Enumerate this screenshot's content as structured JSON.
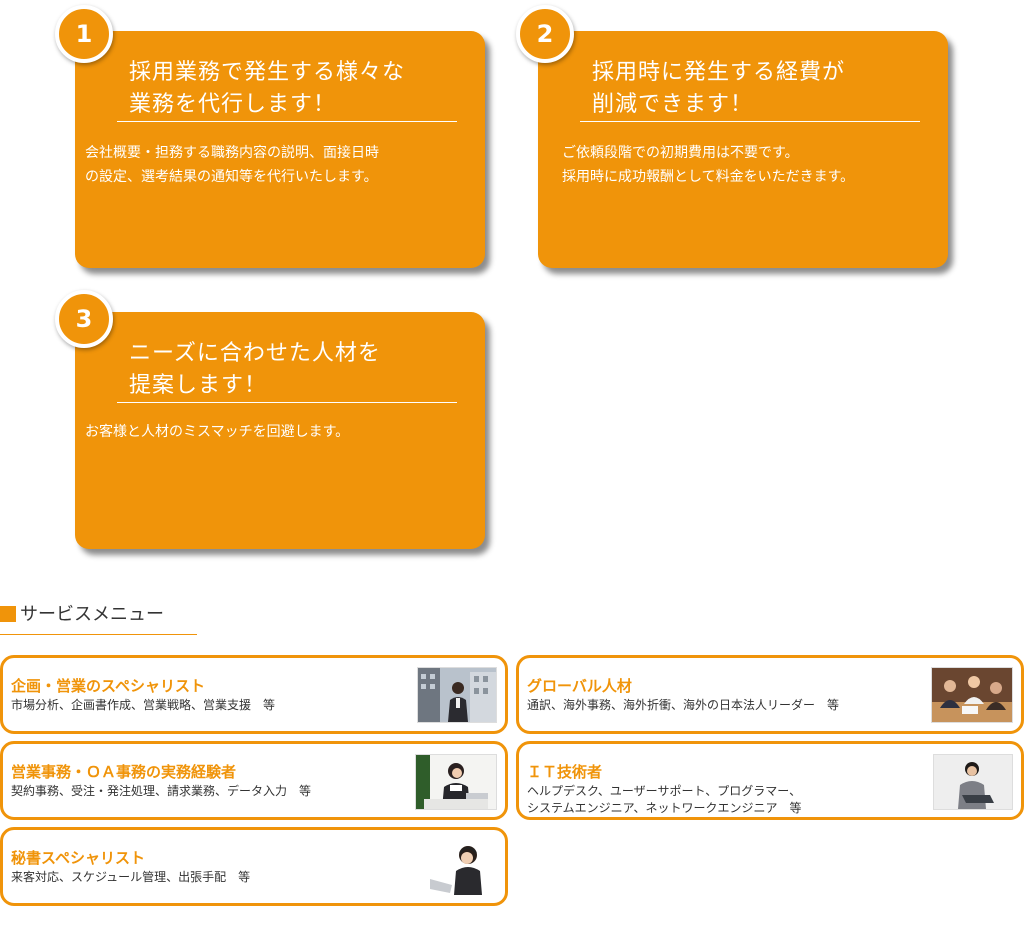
{
  "features": [
    {
      "number": "1",
      "title": "採用業務で発生する様々な\n業務を代行します！",
      "body": "会社概要・担務する職務内容の説明、面接日時\nの設定、選考結果の通知等を代行いたします。"
    },
    {
      "number": "2",
      "title": "採用時に発生する経費が\n削減できます！",
      "body": "ご依頼段階での初期費用は不要です。\n採用時に成功報酬として料金をいただきます。"
    },
    {
      "number": "3",
      "title": "ニーズに合わせた人材を\n提案します！",
      "body": "お客様と人材のミスマッチを回避します。"
    }
  ],
  "service_menu": {
    "heading": "サービスメニュー",
    "items": [
      {
        "title": "企画・営業のスペシャリスト",
        "desc": "市場分析、企画書作成、営業戦略、営業支援　等",
        "photo": "businesswoman-city-photo"
      },
      {
        "title": "グローバル人材",
        "desc": "通訳、海外事務、海外折衝、海外の日本法人リーダー　等",
        "photo": "meeting-photo"
      },
      {
        "title": "営業事務・ＯＡ事務の実務経験者",
        "desc": "契約事務、受注・発注処理、請求業務、データ入力　等",
        "photo": "office-worker-phone-photo"
      },
      {
        "title": "ＩＴ技術者",
        "desc": "ヘルプデスク、ユーザーサポート、プログラマー、\nシステムエンジニア、ネットワークエンジニア　等",
        "photo": "engineer-laptop-photo"
      },
      {
        "title": "秘書スペシャリスト",
        "desc": "来客対応、スケジュール管理、出張手配　等",
        "photo": "secretary-headset-photo"
      }
    ]
  },
  "colors": {
    "accent": "#f0940a",
    "text": "#333333"
  }
}
